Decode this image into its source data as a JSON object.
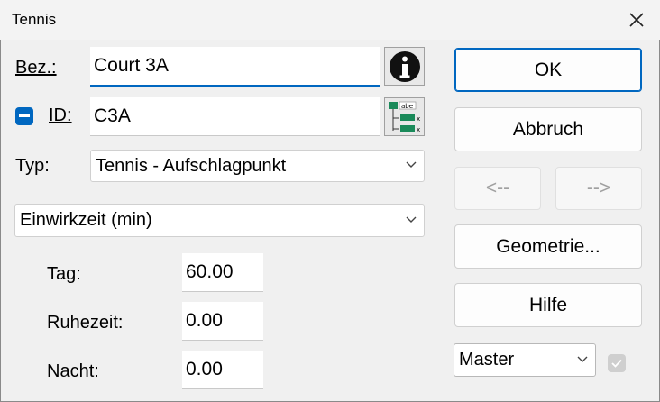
{
  "window": {
    "title": "Tennis"
  },
  "form": {
    "bez_label": "Bez.:",
    "bez_value": "Court 3A",
    "id_label": "ID:",
    "id_value": "C3A",
    "typ_label": "Typ:",
    "typ_value": "Tennis - Aufschlagpunkt",
    "einwirk_value": "Einwirkzeit (min)",
    "tag_label": "Tag:",
    "tag_value": "60.00",
    "ruhe_label": "Ruhezeit:",
    "ruhe_value": "0.00",
    "nacht_label": "Nacht:",
    "nacht_value": "0.00"
  },
  "buttons": {
    "ok": "OK",
    "abbruch": "Abbruch",
    "prev": "<--",
    "next": "-->",
    "geometrie": "Geometrie...",
    "hilfe": "Hilfe"
  },
  "master_select": {
    "value": "Master"
  },
  "icons": {
    "info": "info-icon",
    "table": "table-icon",
    "close": "close-icon",
    "chevron": "chevron-down-icon"
  },
  "colors": {
    "accent": "#0067c0"
  }
}
